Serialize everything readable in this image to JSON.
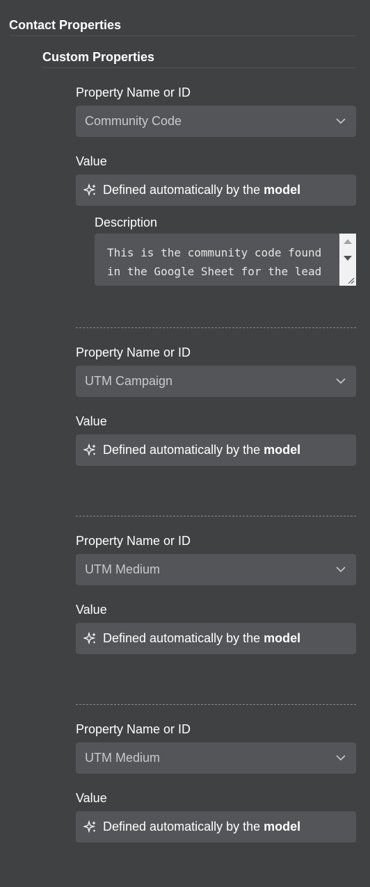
{
  "section": {
    "title": "Contact Properties",
    "subtitle": "Custom Properties"
  },
  "properties": [
    {
      "name_label": "Property Name or ID",
      "name_value": "Community Code",
      "value_label": "Value",
      "value_prefix": "Defined automatically by the",
      "value_emph": "model",
      "description_label": "Description",
      "description_text": "This is the community code found in the Google Sheet for the lead"
    },
    {
      "name_label": "Property Name or ID",
      "name_value": "UTM Campaign",
      "value_label": "Value",
      "value_prefix": "Defined automatically by the",
      "value_emph": "model"
    },
    {
      "name_label": "Property Name or ID",
      "name_value": "UTM Medium",
      "value_label": "Value",
      "value_prefix": "Defined automatically by the",
      "value_emph": "model"
    },
    {
      "name_label": "Property Name or ID",
      "name_value": "UTM Medium",
      "value_label": "Value",
      "value_prefix": "Defined automatically by the",
      "value_emph": "model"
    }
  ],
  "icons": {
    "sparkle": "sparkle-icon",
    "chevron": "chevron-down-icon",
    "resize": "resize-grip-icon"
  }
}
